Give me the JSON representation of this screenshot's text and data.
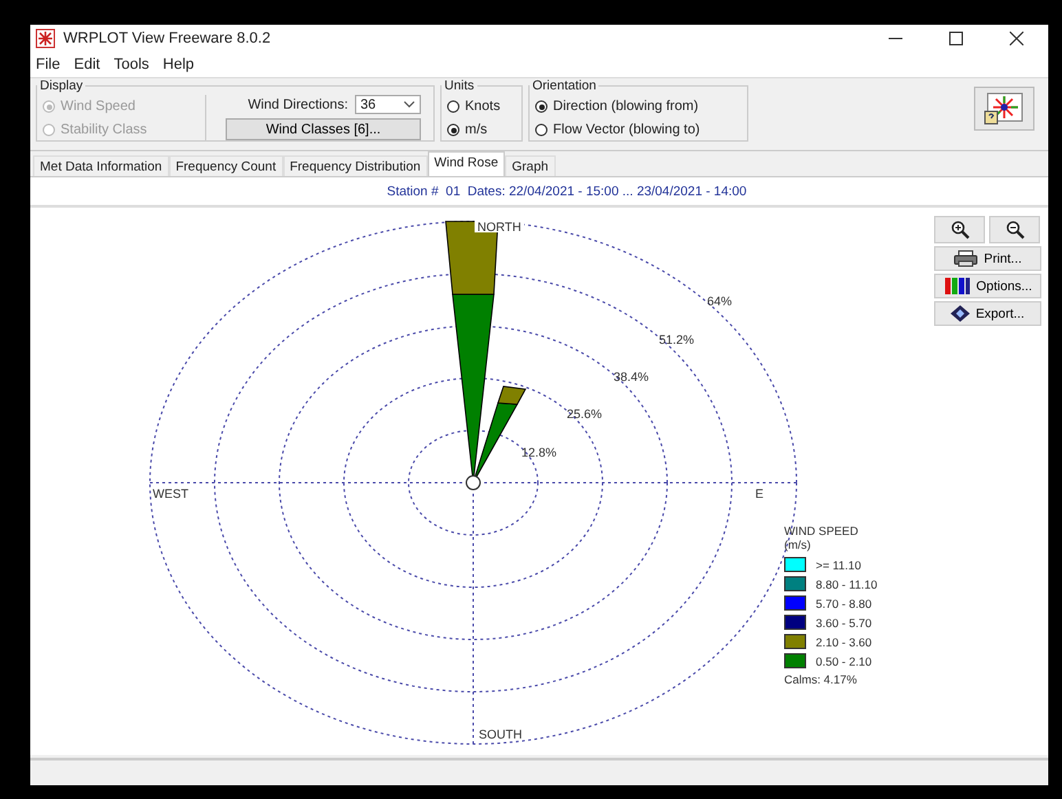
{
  "window": {
    "title": "WRPLOT View Freeware 8.0.2"
  },
  "menu": [
    "File",
    "Edit",
    "Tools",
    "Help"
  ],
  "display": {
    "label": "Display",
    "options": [
      {
        "label": "Wind Speed",
        "selected": true,
        "disabled": true
      },
      {
        "label": "Stability Class",
        "selected": false,
        "disabled": true
      }
    ],
    "wind_directions": {
      "label": "Wind Directions:",
      "value": "36"
    },
    "wind_classes_button": "Wind Classes [6]..."
  },
  "units": {
    "label": "Units",
    "options": [
      {
        "label": "Knots",
        "selected": false
      },
      {
        "label": "m/s",
        "selected": true
      }
    ]
  },
  "orientation": {
    "label": "Orientation",
    "options": [
      {
        "label": "Direction (blowing from)",
        "selected": true
      },
      {
        "label": "Flow Vector (blowing to)",
        "selected": false
      }
    ]
  },
  "tabs": [
    {
      "label": "Met Data Information",
      "selected": false
    },
    {
      "label": "Frequency Count",
      "selected": false
    },
    {
      "label": "Frequency Distribution",
      "selected": false
    },
    {
      "label": "Wind Rose",
      "selected": true
    },
    {
      "label": "Graph",
      "selected": false
    }
  ],
  "station_line": "Station #  01  Dates: 22/04/2021 - 15:00 ... 23/04/2021 - 14:00",
  "rose": {
    "north": "NORTH",
    "west": "WEST",
    "east": "E",
    "south": "SOUTH",
    "rings": [
      "12.8%",
      "25.6%",
      "38.4%",
      "51.2%",
      "64%"
    ]
  },
  "side_buttons": [
    {
      "kind": "zoom-in"
    },
    {
      "kind": "zoom-out"
    },
    {
      "kind": "print",
      "label": "Print..."
    },
    {
      "kind": "options",
      "label": "Options..."
    },
    {
      "kind": "export",
      "label": "Export..."
    }
  ],
  "legend": {
    "title": "WIND SPEED",
    "unit": "(m/s)",
    "items": [
      {
        "label": ">= 11.10",
        "color": "#00ffff"
      },
      {
        "label": "8.80 - 11.10",
        "color": "#008080"
      },
      {
        "label": "5.70 - 8.80",
        "color": "#0000ff"
      },
      {
        "label": "3.60 - 5.70",
        "color": "#000080"
      },
      {
        "label": "2.10 - 3.60",
        "color": "#808000"
      },
      {
        "label": "0.50 - 2.10",
        "color": "#008000"
      }
    ],
    "calms": "Calms: 4.17%"
  }
}
